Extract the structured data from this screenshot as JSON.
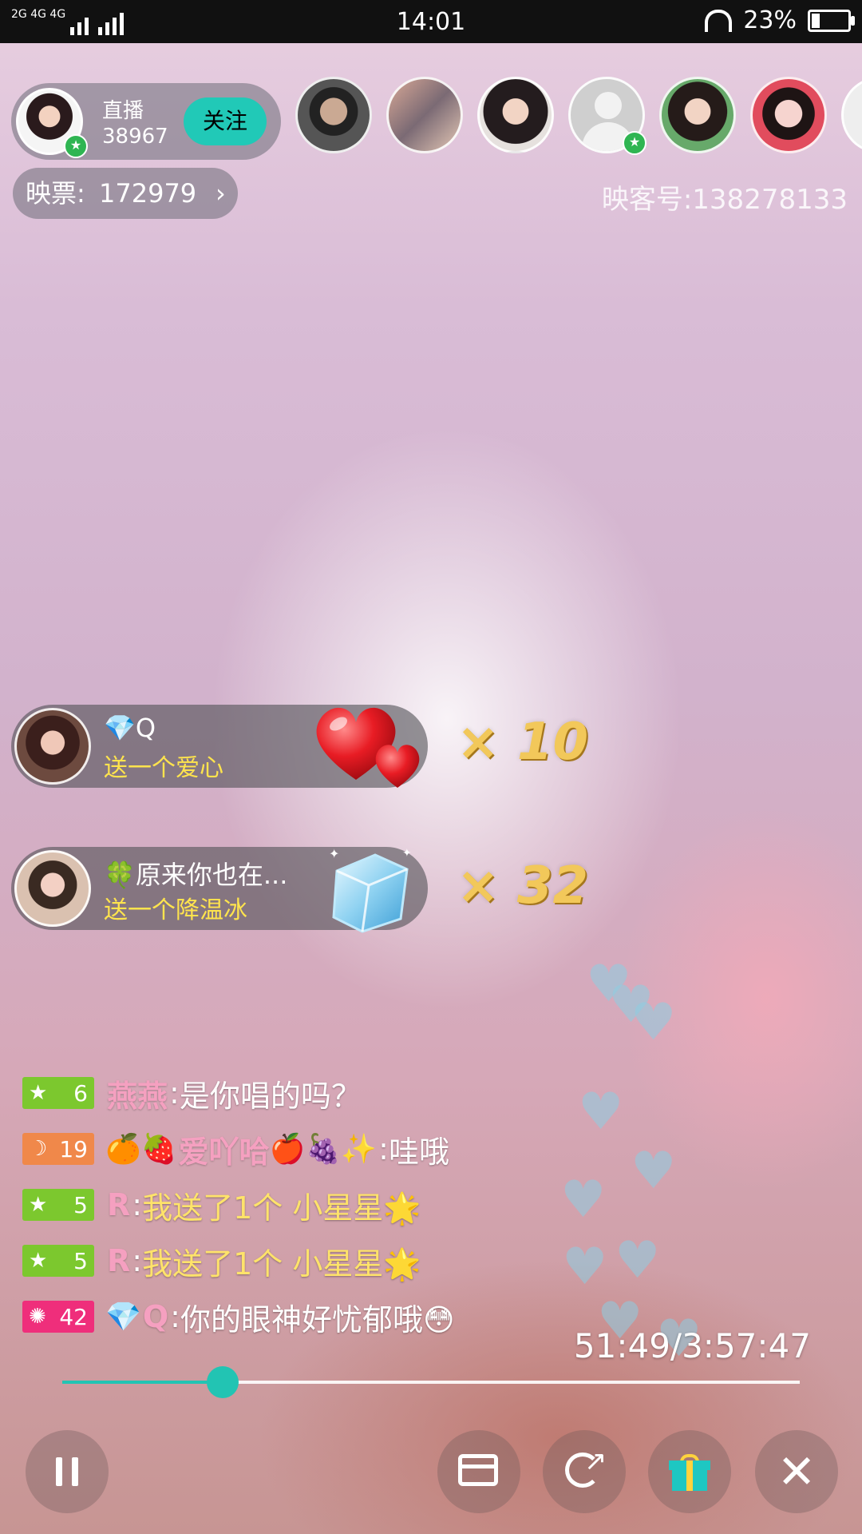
{
  "status_bar": {
    "network": "2G 4G 4G",
    "time": "14:01",
    "battery": "23%",
    "battery_level": 0.23
  },
  "host": {
    "label": "直播",
    "count": "38967",
    "follow_label": "关注"
  },
  "ticket": {
    "label": "映票:",
    "value": "172979",
    "chevron": "›"
  },
  "room_id": "映客号:138278133",
  "gifts": [
    {
      "name": "💎Q",
      "action": "送一个爱心",
      "count": "× 10",
      "icon": "heart-icon"
    },
    {
      "name": "🍀原来你也在...",
      "action": "送一个降温冰",
      "count": "× 32",
      "icon": "ice-cube-icon"
    }
  ],
  "chat": [
    {
      "level": "6",
      "level_icon": "★",
      "badge_color": "#7cc82e",
      "user": "燕燕",
      "prefix": "",
      "suffix": "",
      "text": "是你唱的吗？"
    },
    {
      "level": "19",
      "level_icon": "☽",
      "badge_color": "#f0884a",
      "user": "爱吖哈",
      "prefix": "🍊🍓",
      "suffix": "🍎🍇✨",
      "text": "哇哦"
    },
    {
      "level": "5",
      "level_icon": "★",
      "badge_color": "#7cc82e",
      "user": "R",
      "prefix": "",
      "suffix": "",
      "text": "我送了1个 小星星🌟"
    },
    {
      "level": "5",
      "level_icon": "★",
      "badge_color": "#7cc82e",
      "user": "R",
      "prefix": "",
      "suffix": "",
      "text": "我送了1个 小星星🌟"
    },
    {
      "level": "42",
      "level_icon": "✺",
      "badge_color": "#ef2e7b",
      "user": "Q",
      "prefix": "💎",
      "suffix": "",
      "text": "你的眼神好忧郁哦😳"
    }
  ],
  "playback": {
    "time": "51:49/3:57:47",
    "progress": 0.2177
  },
  "toolbar": {
    "close_label": "✕"
  }
}
